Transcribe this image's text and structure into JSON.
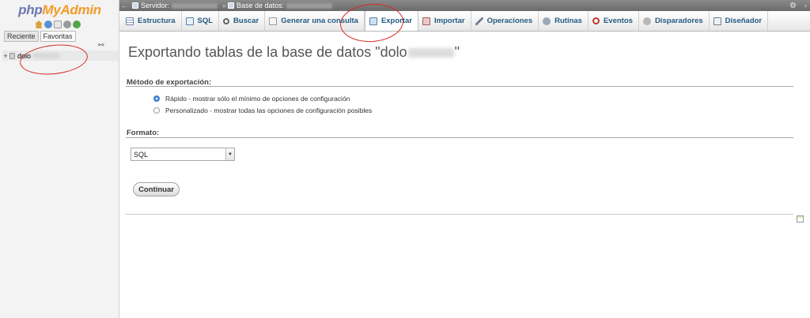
{
  "navigation": {
    "logo_php": "php",
    "logo_myadmin": "MyAdmin",
    "quick_icons": [
      "home-icon",
      "help-icon",
      "docs-icon",
      "settings-icon",
      "reload-icon"
    ],
    "tabs": [
      {
        "label": "Reciente"
      },
      {
        "label": "Favoritas"
      }
    ],
    "db_prefix": "dolo"
  },
  "topbar": {
    "server_label": "Servidor:",
    "database_label": "Base de datos:"
  },
  "tabs": [
    {
      "label": "Estructura",
      "icon": "structure"
    },
    {
      "label": "SQL",
      "icon": "sql"
    },
    {
      "label": "Buscar",
      "icon": "search"
    },
    {
      "label": "Generar una consulta",
      "icon": "query"
    },
    {
      "label": "Exportar",
      "icon": "export"
    },
    {
      "label": "Importar",
      "icon": "import"
    },
    {
      "label": "Operaciones",
      "icon": "operations"
    },
    {
      "label": "Rutinas",
      "icon": "routines"
    },
    {
      "label": "Eventos",
      "icon": "events"
    },
    {
      "label": "Disparadores",
      "icon": "triggers"
    },
    {
      "label": "Diseñador",
      "icon": "designer"
    }
  ],
  "main": {
    "title_prefix": "Exportando tablas de la base de datos \"dolo",
    "title_suffix": "\"",
    "export_method": {
      "heading": "Método de exportación:",
      "options": [
        {
          "label": "Rápido - mostrar sólo el mínimo de opciones de configuración",
          "checked": true
        },
        {
          "label": "Personalizado - mostrar todas las opciones de configuración posibles",
          "checked": false
        }
      ]
    },
    "format": {
      "heading": "Formato:",
      "selected": "SQL"
    },
    "continue_label": "Continuar"
  },
  "colors": {
    "accent": "#235a81",
    "annotation": "#d62a22"
  }
}
